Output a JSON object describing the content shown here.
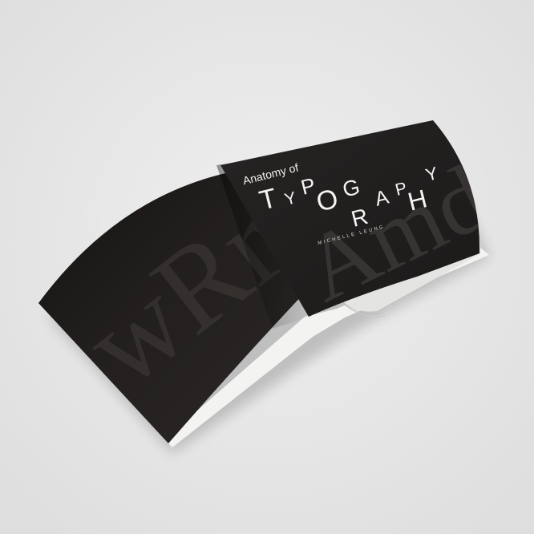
{
  "book": {
    "title_line1": "Anatomy of",
    "title_letters": [
      "T",
      "Y",
      "P",
      "O",
      "G",
      "R",
      "A",
      "P",
      "H",
      "Y"
    ],
    "author": "MICHELLE LEUNG",
    "front_bg_text": "Amdn",
    "back_bg_text": "ZwRr"
  },
  "colors": {
    "background": "#e9e9e9",
    "cover": "#201e1d",
    "title": "#f4f4f4"
  }
}
